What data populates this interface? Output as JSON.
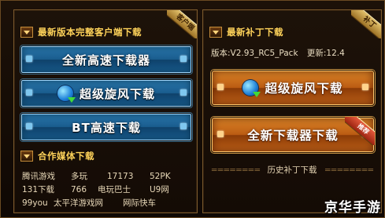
{
  "left": {
    "client_section": {
      "title": "最新版本完整客户端下载",
      "ribbon": "客户端"
    },
    "buttons": [
      {
        "label": "全新高速下载器",
        "icon": "none"
      },
      {
        "label": "超级旋风下载",
        "icon": "download-globe-icon"
      },
      {
        "label": "BT高速下载",
        "icon": "none"
      }
    ],
    "media_section": {
      "title": "合作媒体下载"
    },
    "media_rows": [
      [
        "腾讯游戏",
        "多玩",
        "17173",
        "52PK"
      ],
      [
        "131下载",
        "766",
        "电玩巴士",
        "U9网"
      ],
      [
        "99you",
        "太平洋游戏网",
        "网际快车"
      ]
    ]
  },
  "right": {
    "patch_section": {
      "title": "最新补丁下载",
      "ribbon": "补丁"
    },
    "version_label": "版本:V2.93_RC5_Pack",
    "update_label": "更新:12.4",
    "buttons": [
      {
        "label": "超级旋风下载",
        "icon": "download-globe-icon"
      },
      {
        "label": "全新下载器下载",
        "badge": "推荐"
      }
    ],
    "history_dash_left": "========",
    "history_label": "历史补丁下载",
    "history_dash_right": "========"
  },
  "watermark": "京华手游",
  "colors": {
    "title_gold": "#ffd35a",
    "blue_button": "#1a5e90",
    "orange_button": "#b95a12",
    "border": "#7b5a2c"
  }
}
